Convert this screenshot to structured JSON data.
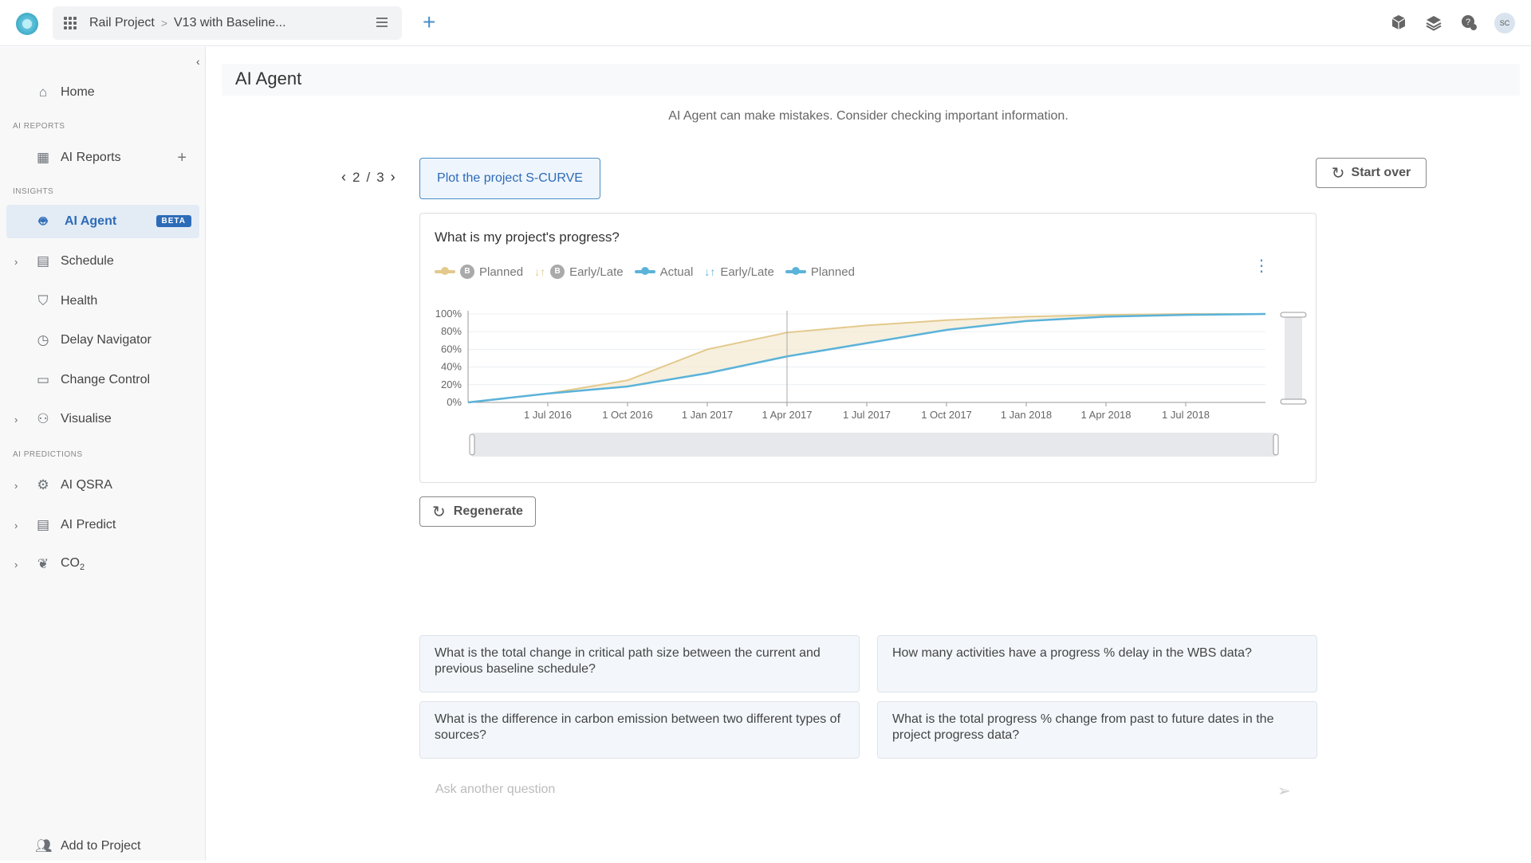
{
  "topbar": {
    "breadcrumb": [
      "Rail Project",
      "V13 with Baseline..."
    ],
    "separator": ">",
    "avatar_initials": "SC",
    "icons": [
      "cube-icon",
      "layers-icon",
      "help-chat-icon"
    ]
  },
  "sidebar": {
    "sections": {
      "ai_reports": "AI REPORTS",
      "insights": "INSIGHTS",
      "ai_predictions": "AI PREDICTIONS"
    },
    "items": {
      "home": "Home",
      "ai_reports": "AI Reports",
      "ai_agent": "AI Agent",
      "schedule": "Schedule",
      "health": "Health",
      "delay_navigator": "Delay Navigator",
      "change_control": "Change Control",
      "visualise": "Visualise",
      "ai_qsra": "AI QSRA",
      "ai_predict": "AI Predict",
      "co2": "CO",
      "co2_sub": "2",
      "add_to_project": "Add to Project"
    },
    "beta_badge": "BETA"
  },
  "main": {
    "title": "AI Agent",
    "disclaimer": "AI Agent can make mistakes. Consider checking important information.",
    "pager": {
      "current": "2",
      "sep": "/",
      "total": "3"
    },
    "query": "Plot the project S-CURVE",
    "start_over": "Start over",
    "regenerate": "Regenerate",
    "ask_placeholder": "Ask another question",
    "suggestions": [
      "What is the total change in critical path size between the current and previous baseline schedule?",
      "How many activities have a progress % delay in the WBS data?",
      "What is the difference in carbon emission between two different types of sources?",
      "What is the total progress % change from past to future dates in the project progress data?"
    ]
  },
  "chart": {
    "question": "What is my project's progress?",
    "legend": [
      {
        "label": "Planned",
        "badge": "B",
        "color": "#e3c98c",
        "kind": "line"
      },
      {
        "label": "Early/Late",
        "badge": "B",
        "color": "#e3c98c",
        "kind": "arrows"
      },
      {
        "label": "Actual",
        "color": "#5bb3d9",
        "kind": "line"
      },
      {
        "label": "Early/Late",
        "color": "#5bb3d9",
        "kind": "arrows"
      },
      {
        "label": "Planned",
        "color": "#5bb3d9",
        "kind": "line"
      }
    ]
  },
  "chart_data": {
    "type": "line",
    "title": "What is my project's progress?",
    "xlabel": "",
    "ylabel": "",
    "y_ticks": [
      "0%",
      "20%",
      "40%",
      "60%",
      "80%",
      "100%"
    ],
    "ylim": [
      0,
      100
    ],
    "x_ticks": [
      "1 Jul 2016",
      "1 Oct 2016",
      "1 Jan 2017",
      "1 Apr 2017",
      "1 Jul 2017",
      "1 Oct 2017",
      "1 Jan 2018",
      "1 Apr 2018",
      "1 Jul 2018"
    ],
    "x": [
      "1 Apr 2016",
      "1 Jul 2016",
      "1 Oct 2016",
      "1 Jan 2017",
      "1 Apr 2017",
      "1 Jul 2017",
      "1 Oct 2017",
      "1 Jan 2018",
      "1 Apr 2018",
      "1 Jul 2018",
      "1 Oct 2018"
    ],
    "series": [
      {
        "name": "Planned",
        "color": "#e3c98c",
        "values": [
          0,
          10,
          25,
          60,
          79,
          87,
          93,
          97,
          99,
          100,
          100
        ]
      },
      {
        "name": "Actual",
        "color": "#5bb3d9",
        "values": [
          0,
          10,
          18,
          33,
          52,
          67,
          82,
          92,
          97,
          99,
          100
        ]
      }
    ],
    "cursor_at": "1 Apr 2017",
    "grid": true,
    "legend_position": "top"
  }
}
